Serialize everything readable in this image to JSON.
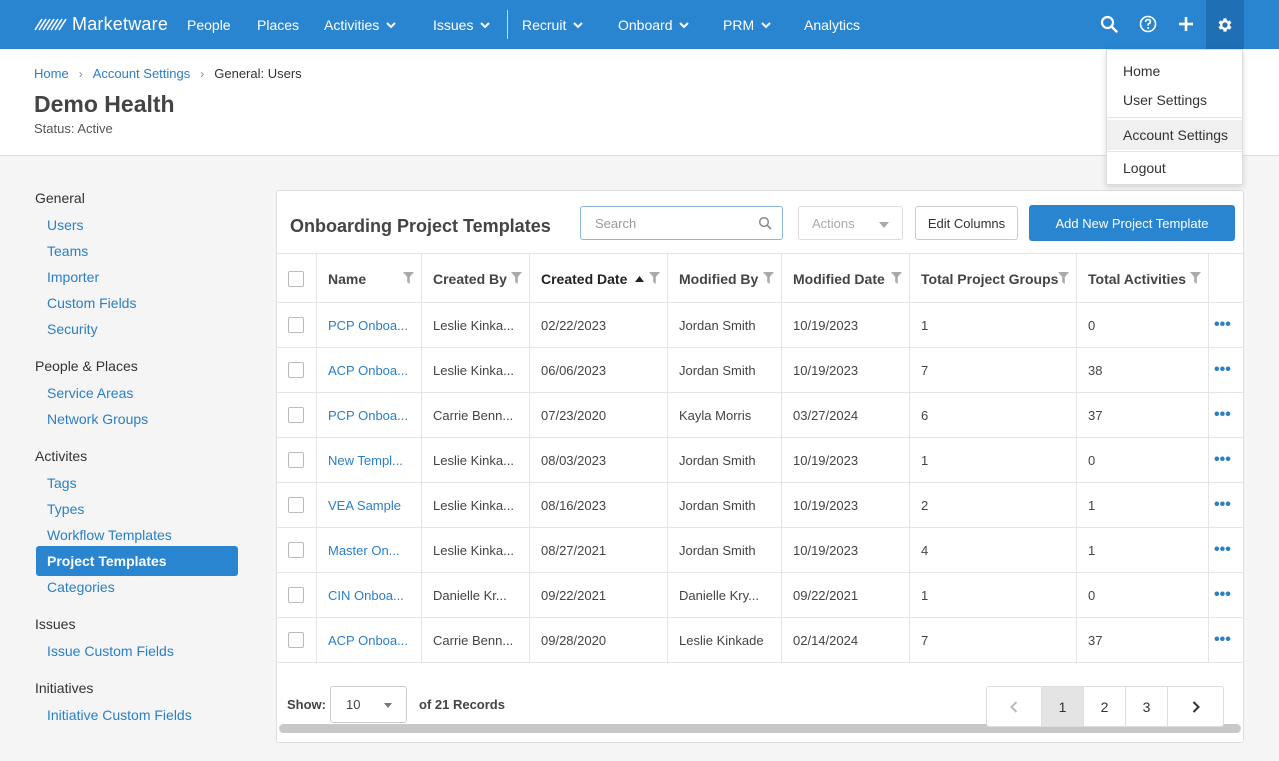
{
  "brand": {
    "name": "Marketware"
  },
  "nav": {
    "items": [
      {
        "label": "People"
      },
      {
        "label": "Places"
      },
      {
        "label": "Activities"
      },
      {
        "label": "Issues"
      },
      {
        "label": "Recruit"
      },
      {
        "label": "Onboard"
      },
      {
        "label": "PRM"
      },
      {
        "label": "Analytics"
      }
    ],
    "icons": [
      "search-icon",
      "help-icon",
      "plus-icon",
      "gear-icon"
    ]
  },
  "user_menu": {
    "items": [
      {
        "label": "Home"
      },
      {
        "label": "User Settings"
      },
      {
        "label": "Account Settings"
      },
      {
        "label": "Logout"
      }
    ],
    "highlighted": "Account Settings"
  },
  "breadcrumb": {
    "home": "Home",
    "account_settings": "Account Settings",
    "current": "General: Users"
  },
  "account": {
    "name": "Demo Health",
    "status": "Status: Active"
  },
  "sidebar": {
    "general": {
      "heading": "General",
      "items": [
        "Users",
        "Teams",
        "Importer",
        "Custom Fields",
        "Security"
      ]
    },
    "people_places": {
      "heading": "People & Places",
      "items": [
        "Service Areas",
        "Network Groups"
      ]
    },
    "activities": {
      "heading": "Activites",
      "items": [
        "Tags",
        "Types",
        "Workflow Templates",
        "Project Templates",
        "Categories"
      ]
    },
    "issues": {
      "heading": "Issues",
      "items": [
        "Issue Custom Fields"
      ]
    },
    "initiatives": {
      "heading": "Initiatives",
      "items": [
        "Initiative Custom Fields"
      ]
    },
    "active_item": "Project Templates"
  },
  "panel": {
    "title": "Onboarding Project Templates",
    "search_placeholder": "Search",
    "actions_label": "Actions",
    "edit_columns_label": "Edit Columns",
    "add_button_label": "Add New Project Template"
  },
  "table": {
    "columns": [
      "Name",
      "Created By",
      "Created Date",
      "Modified By",
      "Modified Date",
      "Total Project Groups",
      "Total Activities"
    ],
    "sorted_column": "Created Date",
    "sort_direction": "ascending",
    "rows": [
      [
        "PCP Onboa...",
        "Leslie Kinka...",
        "02/22/2023",
        "Jordan Smith",
        "10/19/2023",
        "1",
        "0"
      ],
      [
        "ACP Onboa...",
        "Leslie Kinka...",
        "06/06/2023",
        "Jordan Smith",
        "10/19/2023",
        "7",
        "38"
      ],
      [
        "PCP Onboa...",
        "Carrie Benn...",
        "07/23/2020",
        "Kayla Morris",
        "03/27/2024",
        "6",
        "37"
      ],
      [
        "New Templ...",
        "Leslie Kinka...",
        "08/03/2023",
        "Jordan Smith",
        "10/19/2023",
        "1",
        "0"
      ],
      [
        "VEA Sample",
        "Leslie Kinka...",
        "08/16/2023",
        "Jordan Smith",
        "10/19/2023",
        "2",
        "1"
      ],
      [
        "Master On...",
        "Leslie Kinka...",
        "08/27/2021",
        "Jordan Smith",
        "10/19/2023",
        "4",
        "1"
      ],
      [
        "CIN Onboa...",
        "Danielle Kr...",
        "09/22/2021",
        "Danielle Kry...",
        "09/22/2021",
        "1",
        "0"
      ],
      [
        "ACP Onboa...",
        "Carrie Benn...",
        "09/28/2020",
        "Leslie Kinkade",
        "02/14/2024",
        "7",
        "37"
      ]
    ],
    "row_menu_glyph": "•••"
  },
  "footer": {
    "show_label": "Show:",
    "page_size": "10",
    "records_text": "of 21 Records",
    "pages": [
      "1",
      "2",
      "3"
    ],
    "current_page": "1"
  },
  "colors": {
    "nav": "#2a85d0",
    "link": "#2a7fc6",
    "active_sidebar": "#2a85d0"
  }
}
